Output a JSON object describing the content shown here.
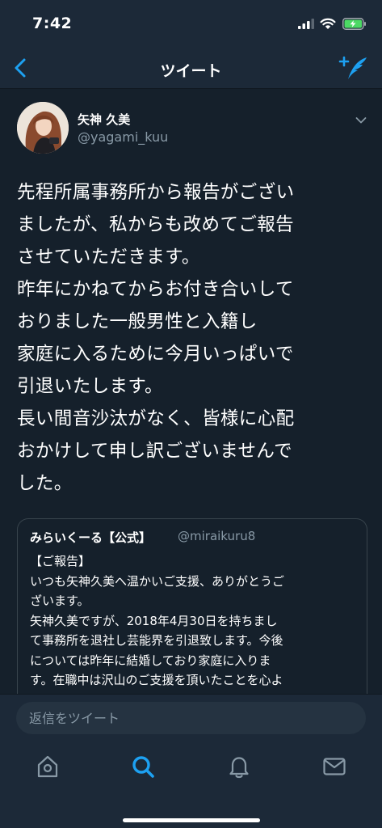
{
  "status_bar": {
    "time": "7:42",
    "icons": [
      "cellular-signal-icon",
      "wifi-icon",
      "battery-charging-icon"
    ]
  },
  "nav": {
    "title": "ツイート",
    "back_icon": "chevron-left-icon",
    "compose_icon": "compose-tweet-icon"
  },
  "tweet": {
    "author_name": "矢神 久美",
    "author_handle": "@yagami_kuu",
    "menu_icon": "chevron-down-icon",
    "text": "先程所属事務所から報告がござい\nましたが、私からも改めてご報告\nさせていただきます。\n昨年にかねてからお付き合いして\nおりました一般男性と入籍し\n家庭に入るために今月いっぱいで\n引退いたします。\n長い間音沙汰がなく、皆様に心配\nおかけして申し訳ございませんで\nした。"
  },
  "quoted_tweet": {
    "author_name": "みらいくーる【公式】",
    "author_handle": "@miraikuru8",
    "text": "【ご報告】\nいつも矢神久美へ温かいご支援、ありがとうご\nざいます。\n矢神久美ですが、2018年4月30日を持ちまし\nて事務所を退社し芸能界を引退致します。今後\nについては昨年に結婚しており家庭に入りま\nす。在職中は沢山のご支援を頂いたことを心よ"
  },
  "reply": {
    "placeholder": "返信をツイート"
  },
  "tab_bar": {
    "tabs": [
      {
        "name": "home",
        "icon": "home-icon",
        "active": false
      },
      {
        "name": "search",
        "icon": "search-icon",
        "active": true
      },
      {
        "name": "notifications",
        "icon": "bell-icon",
        "active": false
      },
      {
        "name": "messages",
        "icon": "mail-icon",
        "active": false
      }
    ]
  },
  "colors": {
    "background": "#15202b",
    "bar_background": "#1c2938",
    "accent": "#1da1f2",
    "secondary_text": "#8899a6",
    "border": "#38444d",
    "battery_fill": "#4cd964"
  }
}
